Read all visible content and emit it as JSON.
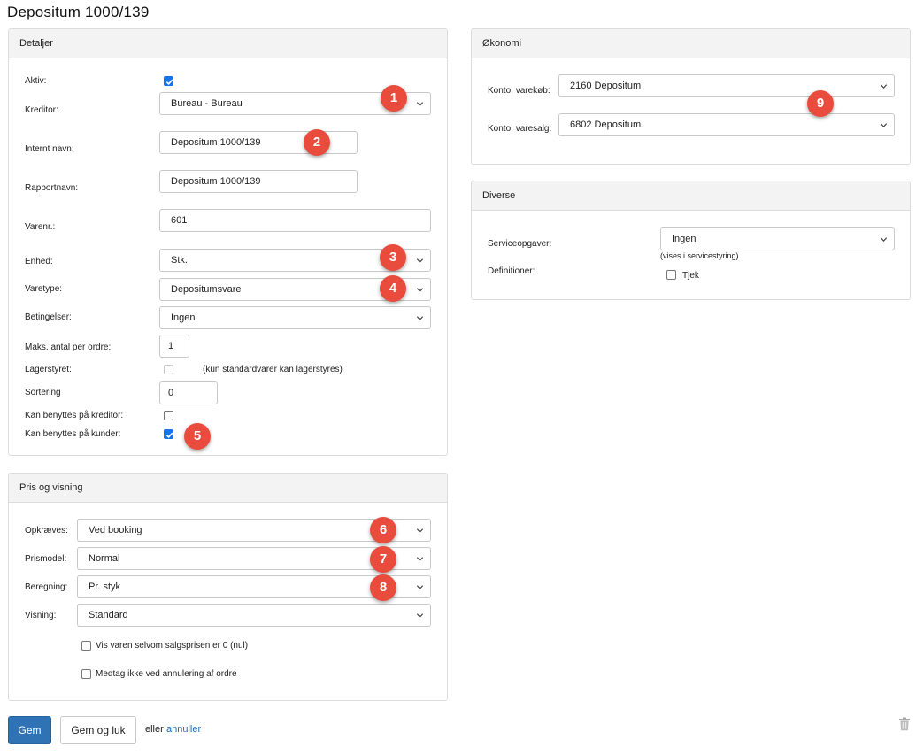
{
  "page": {
    "title": "Depositum 1000/139"
  },
  "details": {
    "header": "Detaljer",
    "aktiv": {
      "label": "Aktiv:",
      "checked": true
    },
    "kreditor": {
      "label": "Kreditor:",
      "value": "Bureau - Bureau"
    },
    "internt_navn": {
      "label": "Internt navn:",
      "value": "Depositum 1000/139"
    },
    "rapportnavn": {
      "label": "Rapportnavn:",
      "value": "Depositum 1000/139"
    },
    "varenr": {
      "label": "Varenr.:",
      "value": "601"
    },
    "enhed": {
      "label": "Enhed:",
      "value": "Stk."
    },
    "varetype": {
      "label": "Varetype:",
      "value": "Depositumsvare"
    },
    "betingelser": {
      "label": "Betingelser:",
      "value": "Ingen"
    },
    "maks_antal": {
      "label": "Maks. antal per ordre:",
      "value": "1"
    },
    "lagerstyret": {
      "label": "Lagerstyret:",
      "checked": false,
      "disabled": true,
      "hint": "(kun standardvarer kan lagerstyres)"
    },
    "sortering": {
      "label": "Sortering",
      "value": "0"
    },
    "kan_kreditor": {
      "label": "Kan benyttes på kreditor:",
      "checked": false
    },
    "kan_kunder": {
      "label": "Kan benyttes på kunder:",
      "checked": true
    }
  },
  "pricing": {
    "header": "Pris og visning",
    "opkraeves": {
      "label": "Opkræves:",
      "value": "Ved booking"
    },
    "prismodel": {
      "label": "Prismodel:",
      "value": "Normal"
    },
    "beregning": {
      "label": "Beregning:",
      "value": "Pr. styk"
    },
    "visning": {
      "label": "Visning:",
      "value": "Standard"
    },
    "vis_varen": {
      "label": "Vis varen selvom salgsprisen er 0 (nul)",
      "checked": false
    },
    "medtag_ikke": {
      "label": "Medtag ikke ved annulering af ordre",
      "checked": false
    }
  },
  "economy": {
    "header": "Økonomi",
    "konto_varekob": {
      "label": "Konto, varekøb:",
      "value": "2160 Depositum"
    },
    "konto_varesalg": {
      "label": "Konto, varesalg:",
      "value": "6802 Depositum"
    }
  },
  "misc": {
    "header": "Diverse",
    "serviceopgaver": {
      "label": "Serviceopgaver:",
      "value": "Ingen",
      "hint": "(vises i servicestyring)"
    },
    "definitioner": {
      "label": "Definitioner:",
      "option_label": "Tjek",
      "checked": false
    }
  },
  "badges": [
    "1",
    "2",
    "3",
    "4",
    "5",
    "6",
    "7",
    "8",
    "9"
  ],
  "actions": {
    "save": "Gem",
    "save_close": "Gem og luk",
    "or": "eller",
    "cancel": "annuller"
  },
  "icons": {
    "select_chevron": "chevron-down-icon",
    "delete": "trash-icon",
    "checkbox_mark": "checkmark-icon"
  },
  "colors": {
    "primary_button": "#2f73b5",
    "badge": "#e94b3c",
    "link": "#1f6eb8",
    "checkbox_checked": "#1a73e8"
  }
}
